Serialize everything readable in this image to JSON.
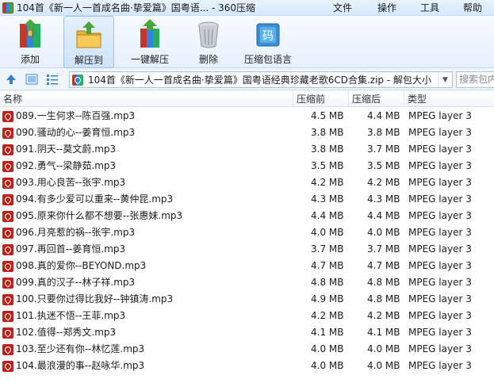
{
  "window": {
    "title": "104首《新一人一首成名曲·挚爱篇》国粤语... - 360压缩",
    "menu": [
      "文件",
      "操作",
      "工具",
      "帮助"
    ]
  },
  "toolbar": {
    "items": [
      {
        "label": "添加",
        "icon": "add-archive-icon"
      },
      {
        "label": "解压到",
        "icon": "extract-to-icon",
        "active": true
      },
      {
        "label": "一键解压",
        "icon": "one-click-extract-icon"
      },
      {
        "label": "删除",
        "icon": "trash-icon"
      },
      {
        "label": "压缩包语言",
        "icon": "archive-language-icon"
      }
    ]
  },
  "address": {
    "path": "104首《新一人一首成名曲·挚爱篇》国粤语经典珍藏老歌6CD合集.zip - 解包大小",
    "search_placeholder": "搜索包内"
  },
  "columns": {
    "name": "名称",
    "size": "压缩前",
    "compressed": "压缩后",
    "type": "类型"
  },
  "files": [
    {
      "name": "089.一生何求--陈百强.mp3",
      "size": "4.5 MB",
      "compressed": "4.4 MB",
      "type": "MPEG layer 3"
    },
    {
      "name": "090.骚动的心--姜育恒.mp3",
      "size": "3.8 MB",
      "compressed": "3.8 MB",
      "type": "MPEG layer 3"
    },
    {
      "name": "091.阴天--莫文蔚.mp3",
      "size": "3.8 MB",
      "compressed": "3.7 MB",
      "type": "MPEG layer 3"
    },
    {
      "name": "092.勇气--梁静茹.mp3",
      "size": "3.5 MB",
      "compressed": "3.5 MB",
      "type": "MPEG layer 3"
    },
    {
      "name": "093.用心良苦--张宇.mp3",
      "size": "4.2 MB",
      "compressed": "4.2 MB",
      "type": "MPEG layer 3"
    },
    {
      "name": "094.有多少爱可以重来--黄仲昆.mp3",
      "size": "4.3 MB",
      "compressed": "4.3 MB",
      "type": "MPEG layer 3"
    },
    {
      "name": "095.原来你什么都不想要--张惠妹.mp3",
      "size": "4.4 MB",
      "compressed": "4.4 MB",
      "type": "MPEG layer 3"
    },
    {
      "name": "096.月亮惹的祸--张宇.mp3",
      "size": "4.0 MB",
      "compressed": "4.0 MB",
      "type": "MPEG layer 3"
    },
    {
      "name": "097.再回首--姜育恒.mp3",
      "size": "3.7 MB",
      "compressed": "3.7 MB",
      "type": "MPEG layer 3"
    },
    {
      "name": "098.真的爱你--BEYOND.mp3",
      "size": "4.7 MB",
      "compressed": "4.7 MB",
      "type": "MPEG layer 3"
    },
    {
      "name": "099.真的汉子--林子祥.mp3",
      "size": "4.8 MB",
      "compressed": "4.8 MB",
      "type": "MPEG layer 3"
    },
    {
      "name": "100.只要你过得比我好--钟镇涛.mp3",
      "size": "4.9 MB",
      "compressed": "4.8 MB",
      "type": "MPEG layer 3"
    },
    {
      "name": "101.执迷不悟--王菲.mp3",
      "size": "4.2 MB",
      "compressed": "4.2 MB",
      "type": "MPEG layer 3"
    },
    {
      "name": "102.值得--郑秀文.mp3",
      "size": "4.1 MB",
      "compressed": "4.1 MB",
      "type": "MPEG layer 3"
    },
    {
      "name": "103.至少还有你--林忆莲.mp3",
      "size": "4.0 MB",
      "compressed": "4.0 MB",
      "type": "MPEG layer 3"
    },
    {
      "name": "104.最浪漫的事--赵咏华.mp3",
      "size": "4.0 MB",
      "compressed": "4.0 MB",
      "type": "MPEG layer 3"
    }
  ]
}
